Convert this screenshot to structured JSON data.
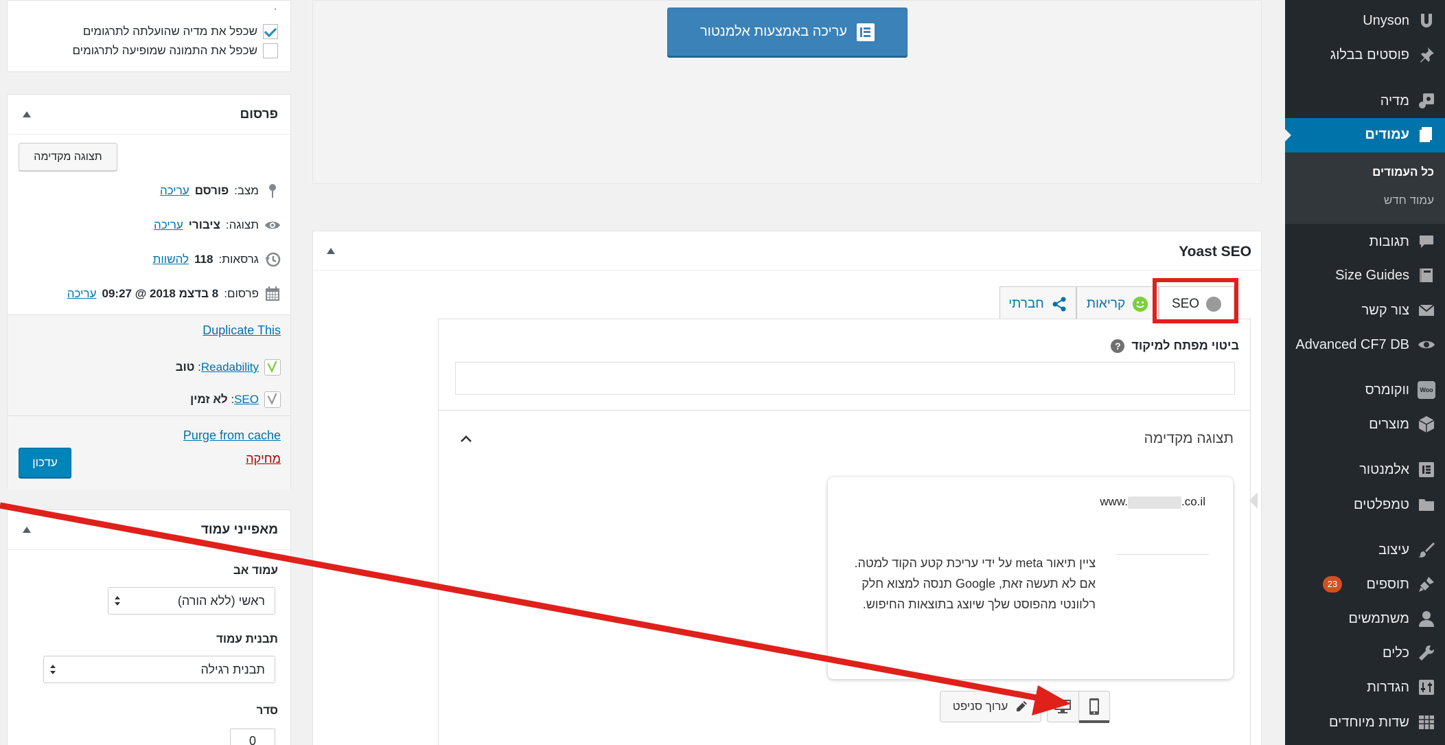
{
  "admin_menu": {
    "items": [
      {
        "label": "Unyson",
        "icon": "unyson-icon"
      },
      {
        "label": "פוסטים בבלוג",
        "icon": "pin-icon"
      },
      {
        "label": "מדיה",
        "icon": "media-icon"
      },
      {
        "label": "עמודים",
        "icon": "pages-icon"
      },
      {
        "label": "תגובות",
        "icon": "comments-icon"
      },
      {
        "label": "Size Guides",
        "icon": "book-icon"
      },
      {
        "label": "צור קשר",
        "icon": "mail-icon"
      },
      {
        "label": "Advanced CF7 DB",
        "icon": "eye-icon"
      },
      {
        "label": "ווקומרס",
        "icon": "woocommerce-icon"
      },
      {
        "label": "מוצרים",
        "icon": "box-icon"
      },
      {
        "label": "אלמנטור",
        "icon": "elementor-icon"
      },
      {
        "label": "טמפלטים",
        "icon": "folder-icon"
      },
      {
        "label": "עיצוב",
        "icon": "brush-icon"
      },
      {
        "label": "תוספים",
        "icon": "plugin-icon",
        "badge": "23"
      },
      {
        "label": "משתמשים",
        "icon": "user-icon"
      },
      {
        "label": "כלים",
        "icon": "wrench-icon"
      },
      {
        "label": "הגדרות",
        "icon": "settings-icon"
      },
      {
        "label": "שדות מיוחדים",
        "icon": "table-icon"
      }
    ],
    "woo_icon_text": "Woo",
    "submenu": {
      "all_pages": "כל העמודים",
      "new_page": "עמוד חדש"
    }
  },
  "elementor": {
    "button_label": "עריכה באמצעות אלמנטור"
  },
  "yoast": {
    "title": "Yoast SEO",
    "tabs": {
      "seo": "SEO",
      "readability": "קריאות",
      "social": "חברתי"
    },
    "focus_keyphrase_label": "ביטוי מפתח למיקוד",
    "help": "?",
    "preview_label": "תצוגה מקדימה",
    "snippet_url_prefix": "www.",
    "snippet_url_suffix": ".co.il",
    "snippet_description": "ציין תיאור meta על ידי עריכת קטע הקוד למטה. אם לא תעשה זאת, Google תנסה למצוא חלק רלוונטי מהפוסט שלך שיוצג בתוצאות החיפוש.",
    "edit_snippet_label": "ערוך סניפט"
  },
  "translate_box": {
    "tiny_marker": ".",
    "option1": "שכפל את מדיה שהועלתה לתרגומים",
    "option1_checked": true,
    "option2": "שכפל את התמונה שמופיעה לתרגומים",
    "option2_checked": false
  },
  "publish": {
    "title": "פרסום",
    "preview_button": "תצוגה מקדימה",
    "status_label": "מצב:",
    "status_value": "פורסם",
    "visibility_label": "תצוגה:",
    "visibility_value": "ציבורי",
    "revisions_label": "גרסאות:",
    "revisions_value": "118",
    "compare_link": "להשוות",
    "published_label": "פרסום:",
    "published_value": "8 בדצמ 2018 @ 09:27",
    "edit_link": "עריכה",
    "duplicate_link": "Duplicate This",
    "readability_link": "Readability",
    "readability_value": "טוב",
    "seo_link": "SEO",
    "seo_value": "לא זמין",
    "purge_link": "Purge from cache",
    "delete_link": "מחיקה",
    "update_button": "עדכון"
  },
  "attributes": {
    "title": "מאפייני עמוד",
    "parent_label": "עמוד אב",
    "parent_value": "ראשי (ללא הורה)",
    "template_label": "תבנית עמוד",
    "template_value": "תבנית רגילה",
    "order_label": "סדר",
    "order_value": "0"
  },
  "colors": {
    "sidebar_bg": "#23282d",
    "sidebar_active": "#0073aa",
    "link": "#0073aa",
    "highlight_red": "#e0201b",
    "elementor_button": "#3b82b9",
    "badge": "#d54e21"
  }
}
